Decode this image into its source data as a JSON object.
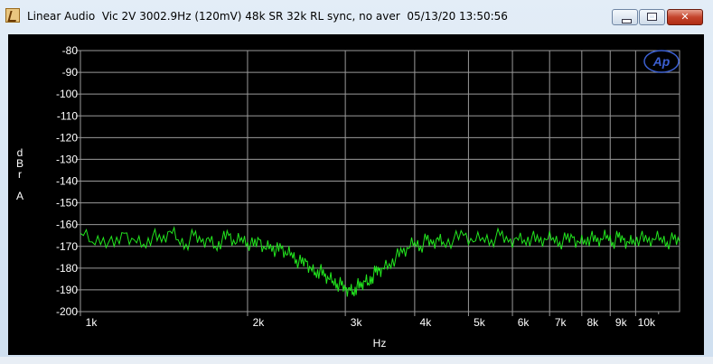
{
  "window": {
    "title": "Linear Audio  Vic 2V 3002.9Hz (120mV) 48k SR 32k RL sync, no aver  05/13/20 13:50:56"
  },
  "colors": {
    "background": "#000000",
    "grid": "#9a9a9a",
    "trace": "#22e61e",
    "text": "#ffffff",
    "logo": "#3b5fd0"
  },
  "logo": {
    "text": "Ap"
  },
  "chart_data": {
    "type": "line",
    "title": "",
    "xlabel": "Hz",
    "ylabel": "dBr A",
    "ylabel_lines": [
      "d",
      "B",
      "r",
      "",
      "A"
    ],
    "x_scale": "log",
    "xlim": [
      1000,
      12000
    ],
    "ylim": [
      -200,
      -80
    ],
    "grid": true,
    "x_ticks": [
      {
        "value": 1000,
        "label": "1k"
      },
      {
        "value": 2000,
        "label": "2k"
      },
      {
        "value": 3000,
        "label": "3k"
      },
      {
        "value": 4000,
        "label": "4k"
      },
      {
        "value": 5000,
        "label": "5k"
      },
      {
        "value": 6000,
        "label": "6k"
      },
      {
        "value": 7000,
        "label": "7k"
      },
      {
        "value": 8000,
        "label": "8k"
      },
      {
        "value": 9000,
        "label": "9k"
      },
      {
        "value": 10000,
        "label": "10k"
      }
    ],
    "y_ticks": [
      {
        "value": -80,
        "label": "-80"
      },
      {
        "value": -90,
        "label": "-90"
      },
      {
        "value": -100,
        "label": "-100"
      },
      {
        "value": -110,
        "label": "-110"
      },
      {
        "value": -120,
        "label": "-120"
      },
      {
        "value": -130,
        "label": "-130"
      },
      {
        "value": -140,
        "label": "-140"
      },
      {
        "value": -150,
        "label": "-150"
      },
      {
        "value": -160,
        "label": "-160"
      },
      {
        "value": -170,
        "label": "-170"
      },
      {
        "value": -180,
        "label": "-180"
      },
      {
        "value": -190,
        "label": "-190"
      },
      {
        "value": -200,
        "label": "-200"
      }
    ],
    "series": [
      {
        "x": [
          1000,
          1050,
          1100,
          1150,
          1200,
          1250,
          1300,
          1350,
          1400,
          1450,
          1500,
          1550,
          1600,
          1650,
          1700,
          1750,
          1800,
          1850,
          1900,
          1950,
          2000,
          2050,
          2100,
          2150,
          2200,
          2250,
          2300,
          2350,
          2400,
          2450,
          2500,
          2550,
          2600,
          2650,
          2700,
          2750,
          2800,
          2850,
          2900,
          2950,
          3000,
          3050,
          3100,
          3150,
          3200,
          3250,
          3300,
          3350,
          3400,
          3450,
          3500,
          3600,
          3700,
          3800,
          3900,
          4000,
          4100,
          4200,
          4300,
          4400,
          4500,
          4700,
          4900,
          5100,
          5300,
          5500,
          5700,
          5900,
          6100,
          6300,
          6500,
          6700,
          6900,
          7100,
          7300,
          7500,
          7700,
          7900,
          8100,
          8300,
          8500,
          8700,
          8900,
          9100,
          9300,
          9500,
          9700,
          9900,
          10200,
          10500,
          10800,
          11100,
          11400,
          11700,
          12000
        ],
        "values": [
          -164,
          -168,
          -166,
          -170,
          -164,
          -167,
          -169,
          -165,
          -168,
          -163,
          -167,
          -169,
          -165,
          -168,
          -166,
          -170,
          -167,
          -165,
          -169,
          -166,
          -168,
          -170,
          -167,
          -171,
          -169,
          -172,
          -171,
          -174,
          -173,
          -176,
          -178,
          -177,
          -180,
          -182,
          -181,
          -184,
          -185,
          -186,
          -187,
          -188,
          -190,
          -189,
          -191,
          -188,
          -189,
          -186,
          -187,
          -184,
          -182,
          -181,
          -180,
          -178,
          -175,
          -173,
          -171,
          -168,
          -170,
          -167,
          -169,
          -166,
          -168,
          -167,
          -165,
          -168,
          -166,
          -167,
          -165,
          -168,
          -166,
          -167,
          -166,
          -168,
          -167,
          -166,
          -168,
          -167,
          -166,
          -168,
          -167,
          -166,
          -168,
          -167,
          -165,
          -168,
          -166,
          -167,
          -168,
          -167,
          -166,
          -168,
          -167,
          -166,
          -168,
          -167,
          -168
        ]
      }
    ]
  }
}
